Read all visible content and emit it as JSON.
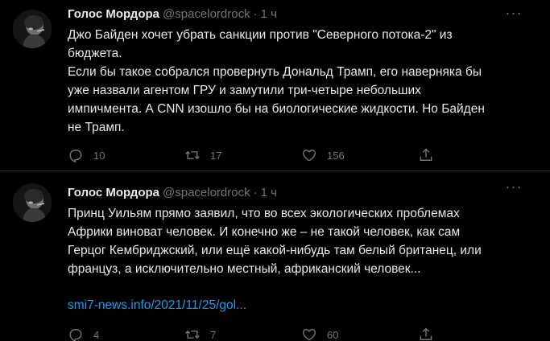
{
  "tweets": [
    {
      "author_name": "Голос Мордора",
      "handle": "@spacelordrock",
      "separator": "·",
      "time": "1 ч",
      "text": "Джо Байден хочет убрать санкции против \"Северного потока-2\" из\nбюджета.\nЕсли бы такое собрался провернуть Дональд Трамп, его наверняка бы\nуже назвали агентом ГРУ и замутили три-четыре небольших\nимпичмента. А CNN изошло бы на биологические жидкости. Но Байден\nне Трамп.",
      "replies": "10",
      "retweets": "17",
      "likes": "156"
    },
    {
      "author_name": "Голос Мордора",
      "handle": "@spacelordrock",
      "separator": "·",
      "time": "1 ч",
      "text": "Принц Уильям прямо заявил, что во всех экологических проблемах\nАфрики виноват человек. И конечно же – не такой человек, как сам\nГерцог Кембриджский, или ещё какой-нибудь там белый британец, или\nфранцуз, а исключительно местный, африканский человек...",
      "link": "smi7-news.info/2021/11/25/gol...",
      "replies": "4",
      "retweets": "7",
      "likes": "60"
    }
  ],
  "more_label": "···",
  "colors": {
    "background": "#000000",
    "text": "#e7e9ea",
    "muted": "#71767b",
    "link": "#1d9bf0",
    "divider": "#2f3336"
  },
  "icons": {
    "reply": "reply-icon",
    "retweet": "retweet-icon",
    "like": "like-icon",
    "share": "share-icon",
    "more": "more-icon"
  }
}
